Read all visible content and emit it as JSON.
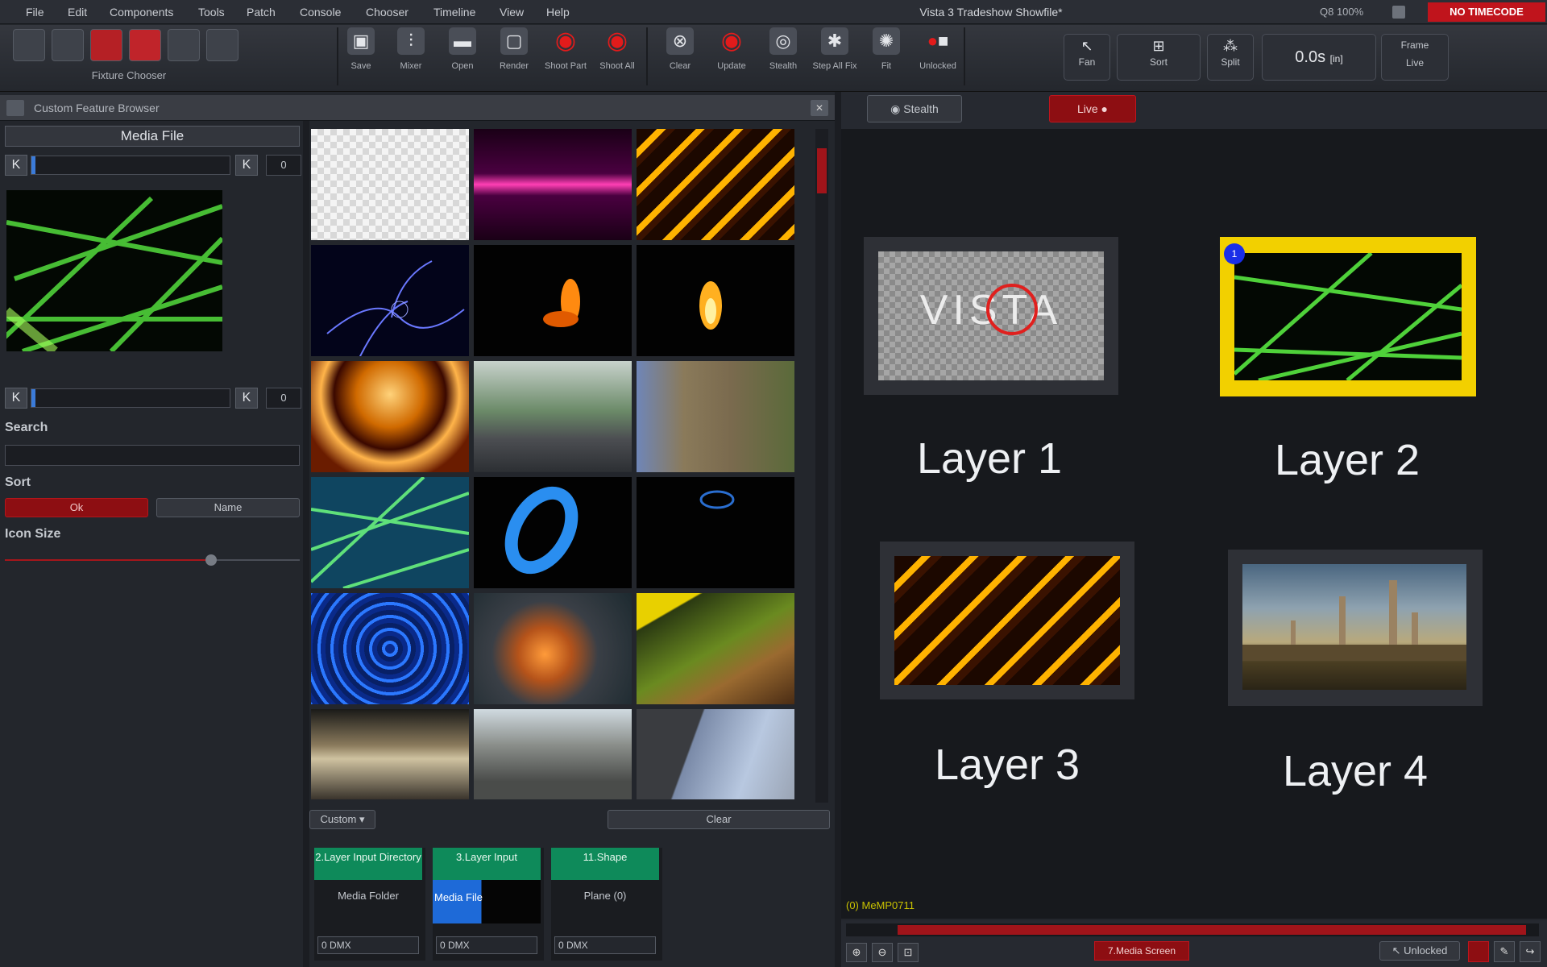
{
  "menu": [
    "File",
    "Edit",
    "Components",
    "Tools",
    "Patch",
    "Console",
    "Chooser",
    "Timeline",
    "View",
    "Help"
  ],
  "app_title": "Vista 3 Tradeshow Showfile*",
  "zoom": "Q8 100%",
  "timecode": "NO TIMECODE",
  "fixture_chooser_label": "Fixture Chooser",
  "toolbar_buttons": [
    {
      "label": "Save",
      "icon": "save-icon"
    },
    {
      "label": "Mixer",
      "icon": "faders-icon"
    },
    {
      "label": "Open",
      "icon": "folder-icon"
    },
    {
      "label": "Render",
      "icon": "monitor-icon"
    },
    {
      "label": "Shoot Part",
      "icon": "target-icon"
    },
    {
      "label": "Shoot All",
      "icon": "target-icon"
    },
    {
      "label": "Clear",
      "icon": "clear-icon"
    },
    {
      "label": "Update",
      "icon": "update-icon"
    },
    {
      "label": "Stealth",
      "icon": "eye-icon"
    },
    {
      "label": "Step All Fix",
      "icon": "step-icon"
    },
    {
      "label": "Fit",
      "icon": "fit-icon"
    },
    {
      "label": "Unlocked",
      "icon": "record-icon"
    }
  ],
  "right_toolbar": [
    {
      "label": "Fan",
      "icon": "cursor-icon"
    },
    {
      "label": "Sort",
      "icon": "sort-icon"
    },
    {
      "label": "Split",
      "icon": "split-icon"
    }
  ],
  "time_display": "0.0s",
  "time_unit": "[in]",
  "frame": {
    "top": "Frame",
    "bottom": "Live"
  },
  "panel_title": "Custom Feature Browser",
  "media_file_header": "Media File",
  "slider1_value": "0",
  "slider2_value": "0",
  "search_label": "Search",
  "search_value": "",
  "sort_label": "Sort",
  "sort_options": [
    "Ok",
    "Name"
  ],
  "icon_size_label": "Icon Size",
  "icon_size_fraction": 0.7,
  "custom_btn": "Custom",
  "clear_btn": "Clear",
  "layer_cards": [
    {
      "title": "2.Layer Input Directory",
      "sub": "Media Folder",
      "dmx": "0 DMX"
    },
    {
      "title": "3.Layer Input",
      "sub": "Media File",
      "dmx": "0 DMX"
    },
    {
      "title": "11.Shape",
      "sub": "Plane (0)",
      "dmx": "0 DMX"
    }
  ],
  "stealth_btn": "Stealth",
  "live_btn": "Live",
  "layers": [
    "Layer 1",
    "Layer 2",
    "Layer 3",
    "Layer 4"
  ],
  "selected_badge": "1",
  "status_file": "(0) MeMP0711",
  "media_screen_btn": "7.Media Screen",
  "unlocked_btn": "Unlocked",
  "colors": {
    "accent_red": "#c0141c",
    "select_yellow": "#f2d000",
    "green": "#0e8a5a"
  }
}
